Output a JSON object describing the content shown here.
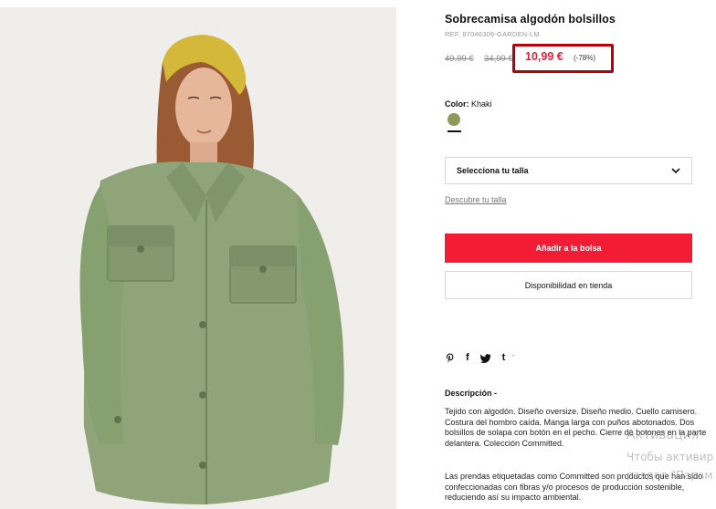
{
  "product": {
    "title": "Sobrecamisa algodón bolsillos",
    "ref": "REF. 87046309-GARDEN-LM",
    "old_price_1": "49,99 €",
    "old_price_2": "34,99 €",
    "current_price": "10,99 €",
    "discount": "(-78%)",
    "image_alt": "Model wearing khaki oversize cotton overshirt"
  },
  "color": {
    "label": "Color:",
    "value": "Khaki",
    "swatch": "#8e9a5a"
  },
  "size": {
    "select_label": "Selecciona tu talla",
    "guide_link": "Descubre tu talla"
  },
  "actions": {
    "add_to_bag": "Añadir a la bolsa",
    "store_availability": "Disponibilidad en tienda"
  },
  "social": {
    "icons": [
      "pinterest-icon",
      "facebook-icon",
      "twitter-icon",
      "tumblr-icon"
    ],
    "pinterest": "℗",
    "facebook": "f",
    "twitter": "🐦",
    "tumblr": "t",
    "extra": "'"
  },
  "description": {
    "title": "Descripción -",
    "paragraph1": "Tejido con algodón. Diseño oversize. Diseño medio. Cuello camisero. Costura del hombro caída. Manga larga con puños abotonados. Dos bolsillos de solapa con botón en el pecho. Cierre de botones en la parte delantera. Colección Committed.",
    "paragraph2": "Las prendas etiquetadas como Committed son productos que han sido confeccionadas con fibras y/o procesos de producción sostenible, reduciendo así su impacto ambiental."
  },
  "watermark": {
    "line1": "Активация",
    "line2": "Чтобы активир",
    "line3": "раздел \"Парам"
  },
  "colors": {
    "accent_red": "#f21d34",
    "price_red": "#e0213a",
    "highlight_border": "#b8000b",
    "jacket_green": "#8fa478"
  }
}
